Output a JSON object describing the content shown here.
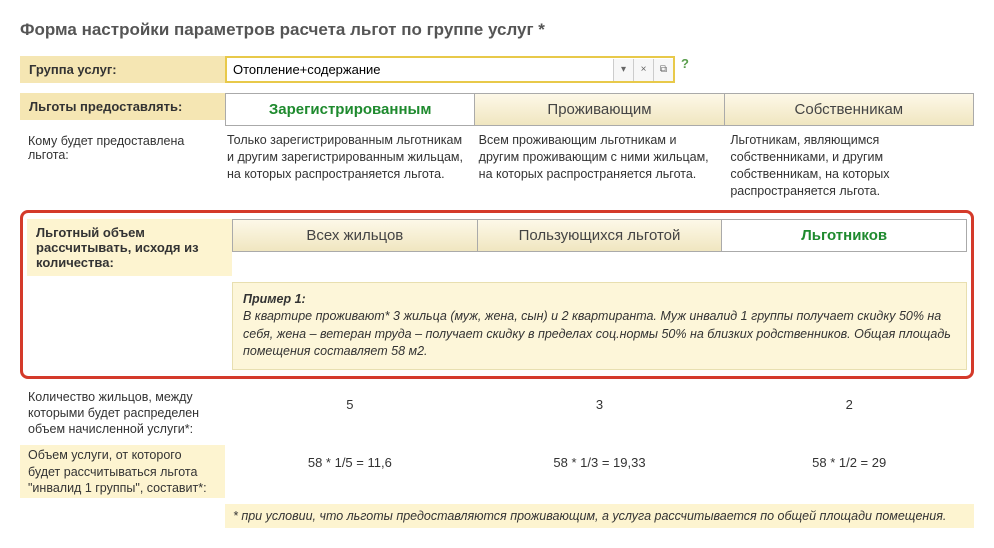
{
  "title": "Форма настройки параметров расчета льгот по группе услуг *",
  "group": {
    "label": "Группа услуг:",
    "value": "Отопление+содержание"
  },
  "provideTo": {
    "label": "Льготы предоставлять:",
    "options": [
      "Зарегистрированным",
      "Проживающим",
      "Собственникам"
    ],
    "descLabel": "Кому будет предоставлена льгота:",
    "desc": [
      "Только зарегистрированным льготникам и другим зарегистрированным жильцам, на которых распространяется льгота.",
      "Всем проживающим льготникам и другим проживающим с ними жильцам, на которых распространяется льгота.",
      "Льготникам, являющимся собственниками, и другим собственникам, на которых распространяется льгота."
    ]
  },
  "volume": {
    "label": "Льготный объем рассчитывать, исходя из количества:",
    "options": [
      "Всех жильцов",
      "Пользующихся льготой",
      "Льготников"
    ]
  },
  "example": {
    "title": "Пример 1:",
    "text": "В квартире проживают* 3 жильца (муж, жена, сын) и 2 квартиранта. Муж инвалид 1 группы получает скидку 50% на себя, жена – ветеран труда – получает скидку в пределах соц.нормы 50% на близких родственников. Общая площадь помещения составляет 58 м2."
  },
  "calcCount": {
    "label": "Количество жильцов, между которыми будет распределен объем начисленной услуги*:",
    "values": [
      "5",
      "3",
      "2"
    ]
  },
  "calcVol": {
    "label": "Объем услуги, от которого будет рассчитываться льгота \"инвалид 1 группы\", составит*:",
    "values": [
      "58 * 1/5 = 11,6",
      "58 * 1/3 = 19,33",
      "58 * 1/2 = 29"
    ]
  },
  "footnote": "* при условии, что льготы предоставляются проживающим, а услуга рассчитывается по общей площади помещения."
}
